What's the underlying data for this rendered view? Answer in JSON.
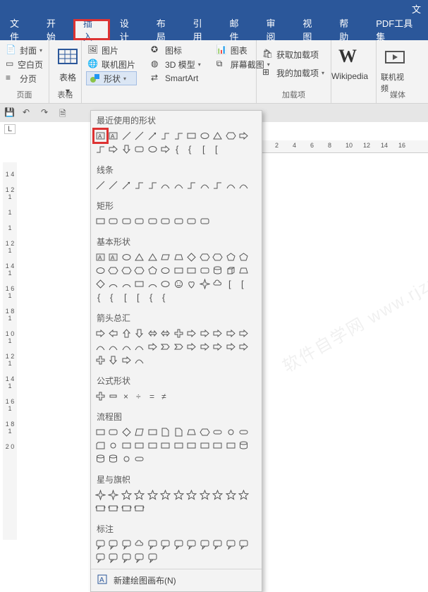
{
  "title_char": "文",
  "watermark": "软件自学网 www.rjzxw.com",
  "menu": [
    "文件",
    "开始",
    "插入",
    "设计",
    "布局",
    "引用",
    "邮件",
    "审阅",
    "视图",
    "帮助",
    "PDF工具集"
  ],
  "menu_selected_index": 2,
  "ribbon": {
    "groups": {
      "g1": {
        "label": "页面",
        "cover": "封面",
        "blank": "空白页",
        "break": "分页"
      },
      "g2": {
        "label": "表格",
        "tables": "表格"
      },
      "g3": {
        "label": "",
        "pic": "图片",
        "onlinepic": "联机图片",
        "shapes": "形状",
        "icons": "图标",
        "model3d": "3D 模型",
        "smartart": "SmartArt",
        "chart": "图表",
        "screenshot": "屏幕截图"
      },
      "g4": {
        "label": "加载项",
        "getaddin": "获取加载项",
        "myaddin": "我的加载项"
      },
      "g5": {
        "wikipedia": "Wikipedia"
      },
      "g6": {
        "label": "媒体",
        "onlinevideo": "联机视频"
      }
    }
  },
  "qat": {
    "tab_label": "L"
  },
  "hruler_ticks": [
    "2",
    "4",
    "6",
    "8",
    "10",
    "12",
    "14",
    "16"
  ],
  "vruler_marks": [
    "1 4",
    "1 2 1",
    "1",
    "1",
    "1 2 1",
    "1 4 1",
    "1 6 1",
    "1 8 1",
    "1 0 1",
    "1 2 1",
    "1 4 1",
    "1 6 1",
    "1 8 1",
    "2 0"
  ],
  "shapes_panel": {
    "sections": {
      "recent": {
        "title": "最近使用的形状",
        "count": 22
      },
      "lines": {
        "title": "线条",
        "count": 12
      },
      "rects": {
        "title": "矩形",
        "count": 9
      },
      "basic": {
        "title": "基本形状",
        "count": 42
      },
      "arrows": {
        "title": "箭头总汇",
        "count": 28
      },
      "equation": {
        "title": "公式形状",
        "count": 6
      },
      "flowchart": {
        "title": "流程图",
        "count": 28
      },
      "stars": {
        "title": "星与旗帜",
        "count": 16
      },
      "callouts": {
        "title": "标注",
        "count": 17
      }
    },
    "footer": "新建绘图画布(N)"
  }
}
